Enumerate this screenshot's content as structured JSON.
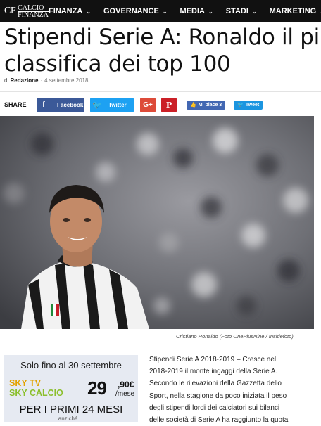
{
  "logo": {
    "mark": "CF",
    "line1": "CALCIO",
    "line2": "FINANZA"
  },
  "nav": [
    {
      "label": "FINANZA"
    },
    {
      "label": "GOVERNANCE"
    },
    {
      "label": "MEDIA"
    },
    {
      "label": "STADI"
    },
    {
      "label": "MARKETING"
    }
  ],
  "article": {
    "title_line1": "Stipendi Serie A: Ronaldo il più p",
    "title_line2": "classifica dei top 100",
    "byline_prefix": "di",
    "author": "Redazione",
    "date": "4 settembre 2018"
  },
  "share": {
    "label": "SHARE",
    "facebook": "Facebook",
    "twitter": "Twitter",
    "gplus": "G+",
    "pinterest": "P",
    "like": "Mi piace 3",
    "tweet": "Tweet"
  },
  "photo": {
    "caption": "Cristiano Ronaldo (Foto OnePlusNine / Insidefoto)"
  },
  "ad": {
    "line1": "Solo fino al 30 settembre",
    "brand1": "SKY TV",
    "brand2": "SKY CALCIO",
    "price": "29",
    "cents": ",90€",
    "per": "/mese",
    "line3": "PER I PRIMI 24 MESI",
    "line4": "anziché ..."
  },
  "body": {
    "lines": [
      "Stipendi Serie A 2018-2019 – Cresce nel",
      "2018-2019 il monte ingaggi della Serie A.",
      "Secondo le rilevazioni della Gazzetta dello",
      "Sport, nella stagione da poco iniziata il peso",
      "degli stipendi lordi dei calciatori sui bilanci",
      "delle società di Serie A ha raggiunto la quota"
    ]
  },
  "colors": {
    "nav_bg": "#111111",
    "facebook": "#3b5998",
    "twitter": "#1da1f2",
    "gplus": "#dd4b39",
    "pinterest": "#cb2027",
    "ad_bg": "#e6eaf2"
  }
}
